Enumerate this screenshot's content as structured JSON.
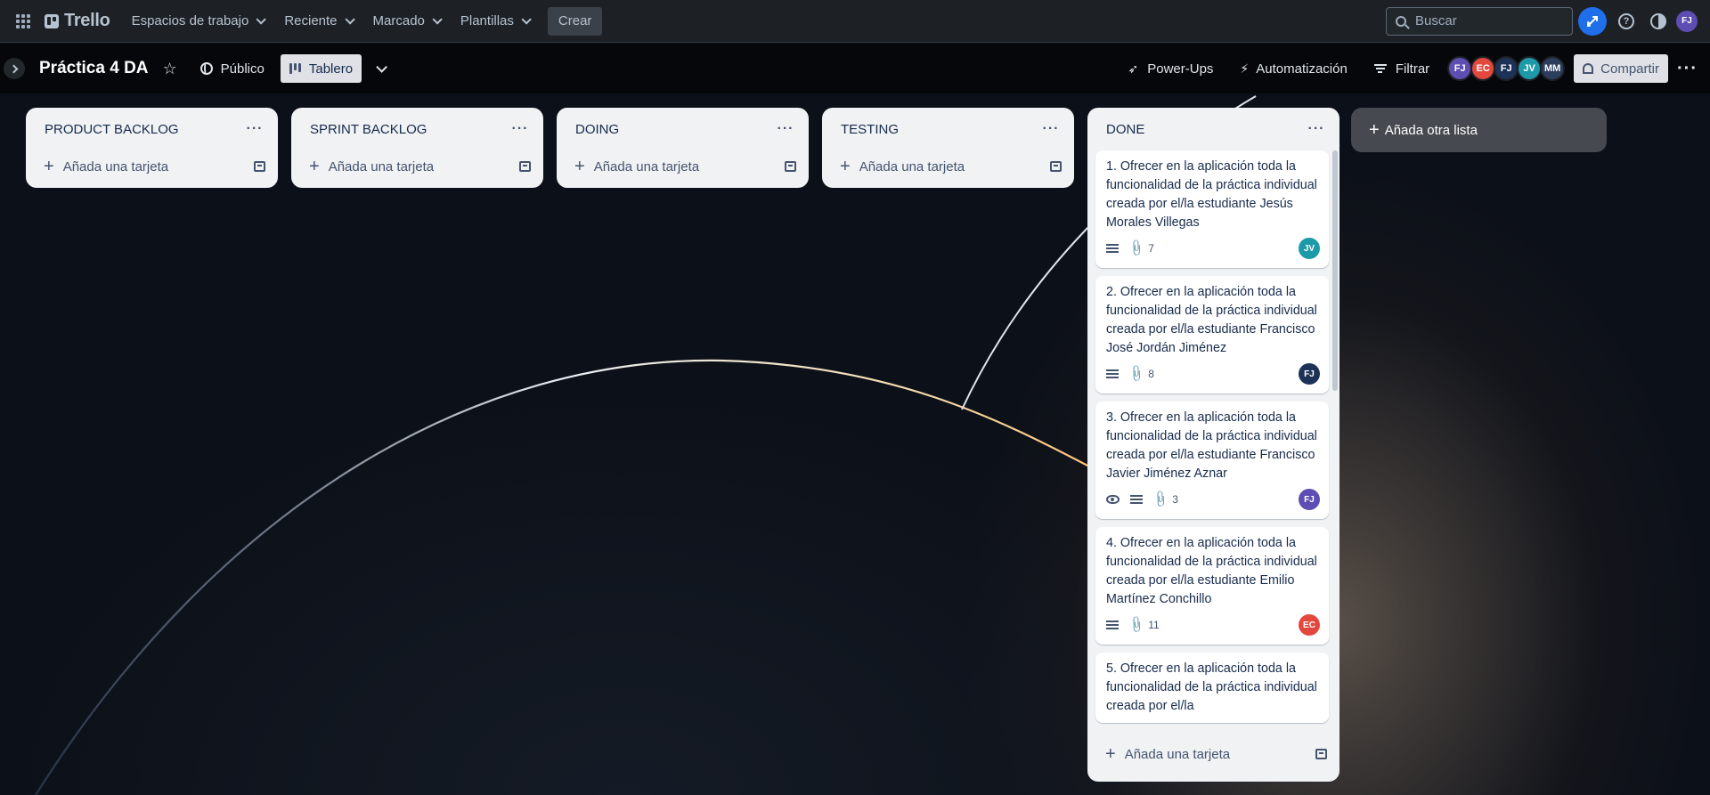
{
  "nav": {
    "logo": "Trello",
    "menus": [
      "Espacios de trabajo",
      "Reciente",
      "Marcado",
      "Plantillas"
    ],
    "create": "Crear",
    "search_placeholder": "Buscar",
    "user_initials": "FJ"
  },
  "board": {
    "title": "Práctica 4 DA",
    "visibility": "Público",
    "view": "Tablero",
    "powerups": "Power-Ups",
    "automation": "Automatización",
    "filter": "Filtrar",
    "share": "Compartir",
    "members": [
      {
        "initials": "FJ",
        "color": "#5e4db2"
      },
      {
        "initials": "EC",
        "color": "#e2483d"
      },
      {
        "initials": "FJ",
        "color": "#1d3257"
      },
      {
        "initials": "JV",
        "color": "#1d9aaa"
      },
      {
        "initials": "MM",
        "color": "#2c3e5d"
      }
    ]
  },
  "lists": [
    {
      "title": "PRODUCT BACKLOG",
      "add_card": "Añada una tarjeta"
    },
    {
      "title": "SPRINT BACKLOG",
      "add_card": "Añada una tarjeta"
    },
    {
      "title": "DOING",
      "add_card": "Añada una tarjeta"
    },
    {
      "title": "TESTING",
      "add_card": "Añada una tarjeta"
    }
  ],
  "done": {
    "title": "DONE",
    "add_card": "Añada una tarjeta",
    "cards": [
      {
        "title": "1. Ofrecer en la aplicación toda la funcionalidad de la práctica individual creada por el/la estudiante Jesús Morales Villegas",
        "attachments": "7",
        "member": "JV",
        "member_color": "#1d9aaa",
        "watch": false
      },
      {
        "title": "2. Ofrecer en la aplicación toda la funcionalidad de la práctica individual creada por el/la estudiante Francisco José Jordán Jiménez",
        "attachments": "8",
        "member": "FJ",
        "member_color": "#1d3257",
        "watch": false
      },
      {
        "title": "3. Ofrecer en la aplicación toda la funcionalidad de la práctica individual creada por el/la estudiante Francisco Javier Jiménez Aznar",
        "attachments": "3",
        "member": "FJ",
        "member_color": "#5e4db2",
        "watch": true
      },
      {
        "title": "4. Ofrecer en la aplicación toda la funcionalidad de la práctica individual creada por el/la estudiante Emilio Martínez Conchillo",
        "attachments": "11",
        "member": "EC",
        "member_color": "#e2483d",
        "watch": false
      },
      {
        "title": "5. Ofrecer en la aplicación toda la funcionalidad de la práctica individual creada por el/la",
        "attachments": "",
        "member": "",
        "member_color": "",
        "watch": false
      }
    ]
  },
  "add_list": "Añada otra lista"
}
